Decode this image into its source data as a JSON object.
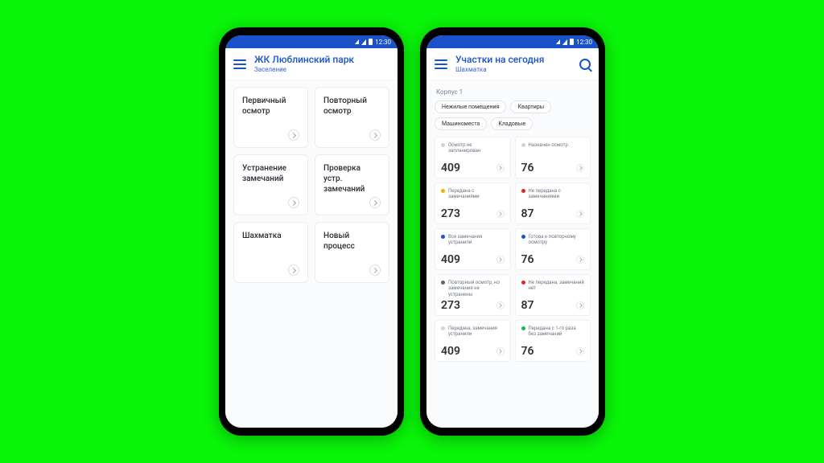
{
  "status": {
    "time": "12:30"
  },
  "colors": {
    "primary": "#1c52c9",
    "dot_gray": "#cfd5dd",
    "dot_yellow": "#f0b100",
    "dot_red": "#e02424",
    "dot_blue": "#1c52c9",
    "dot_dark": "#5b6470",
    "dot_green": "#17b35a"
  },
  "phone1": {
    "header": {
      "title": "ЖК Люблинский парк",
      "subtitle": "Заселение"
    },
    "cards": [
      {
        "title": "Первичный осмотр"
      },
      {
        "title": "Повторный осмотр"
      },
      {
        "title": "Устранение замечаний"
      },
      {
        "title": "Проверка устр. замечаний"
      },
      {
        "title": "Шахматка"
      },
      {
        "title": "Новый процесс"
      }
    ]
  },
  "phone2": {
    "header": {
      "title": "Участки на сегодня",
      "subtitle": "Шахматка"
    },
    "section": "Корпус 1",
    "chips": [
      "Нежилые помещения",
      "Квартиры",
      "Машиноместа",
      "Кладовые"
    ],
    "stats": [
      {
        "dot": "dot_gray",
        "label": "Осмотр не запланирован",
        "value": "409"
      },
      {
        "dot": "dot_gray",
        "label": "Назначен осмотр",
        "value": "76"
      },
      {
        "dot": "dot_yellow",
        "label": "Передана с замечаниями",
        "value": "273"
      },
      {
        "dot": "dot_red",
        "label": "Не передана с замечаниями",
        "value": "87"
      },
      {
        "dot": "dot_blue",
        "label": "Все замечания устранили",
        "value": "409"
      },
      {
        "dot": "dot_blue",
        "label": "Готова к повторному осмотру",
        "value": "76"
      },
      {
        "dot": "dot_dark",
        "label": "Повторный осмотр, но замечания не устранены",
        "value": "273"
      },
      {
        "dot": "dot_red",
        "label": "Не передана, замечаний нет",
        "value": "87"
      },
      {
        "dot": "dot_gray",
        "label": "Передана, замечания устранили",
        "value": "409"
      },
      {
        "dot": "dot_green",
        "label": "Передана с 1-го раза без замечаний",
        "value": "76"
      }
    ]
  }
}
